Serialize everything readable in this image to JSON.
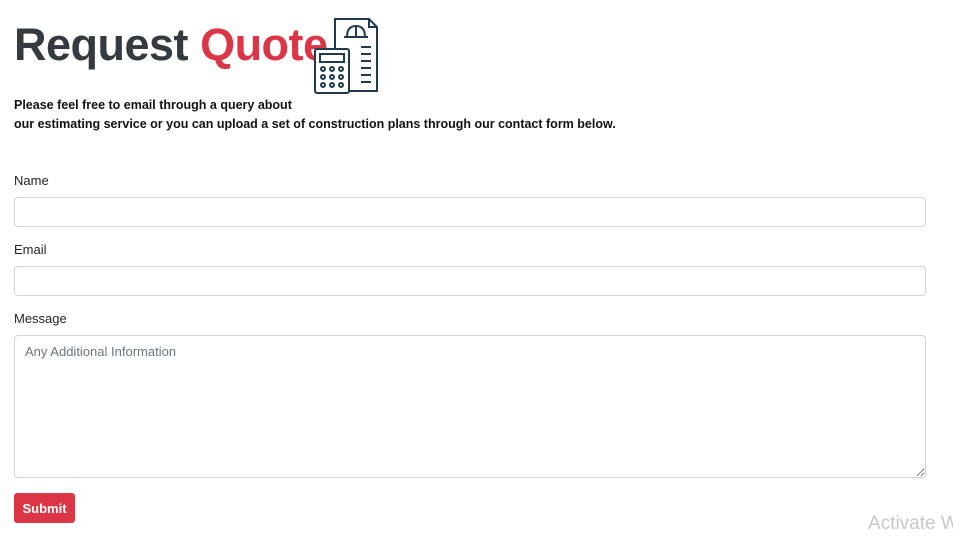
{
  "header": {
    "title_main": "Request",
    "title_accent": "Quote",
    "icon": "calculator-document-hardhat-icon",
    "accent_color": "#dc3545"
  },
  "intro": {
    "line1": "Please feel free to email through a query about",
    "line2": "our estimating service or you can upload a set of construction plans through our contact form below."
  },
  "form": {
    "name_label": "Name",
    "name_value": "",
    "email_label": "Email",
    "email_value": "",
    "message_label": "Message",
    "message_placeholder": "Any Additional Information",
    "submit_label": "Submit"
  },
  "os_watermark": "Activate W"
}
